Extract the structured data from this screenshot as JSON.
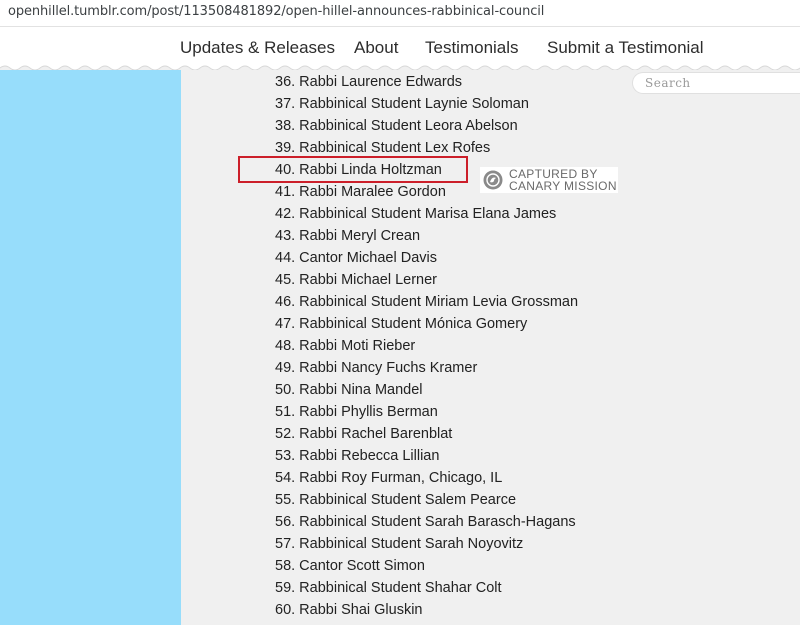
{
  "browser": {
    "url": "openhillel.tumblr.com/post/113508481892/open-hillel-announces-rabbinical-council"
  },
  "nav": {
    "items": [
      {
        "label": "Updates & Releases"
      },
      {
        "label": "About"
      },
      {
        "label": "Testimonials"
      },
      {
        "label": "Submit a Testimonial"
      }
    ]
  },
  "search": {
    "placeholder": "Search"
  },
  "colors": {
    "sidebar": "#97ddfb",
    "highlight_border": "#cc1f2a",
    "background": "#f0f0f0"
  },
  "list": {
    "items": [
      {
        "text": "36. Rabbi Laurence Edwards"
      },
      {
        "text": "37. Rabbinical Student Laynie Soloman"
      },
      {
        "text": "38. Rabbinical Student Leora Abelson"
      },
      {
        "text": "39. Rabbinical Student Lex Rofes"
      },
      {
        "text": "40. Rabbi Linda Holtzman"
      },
      {
        "text": "41. Rabbi Maralee Gordon"
      },
      {
        "text": "42. Rabbinical Student Marisa Elana James"
      },
      {
        "text": "43. Rabbi Meryl Crean"
      },
      {
        "text": "44. Cantor Michael Davis"
      },
      {
        "text": "45. Rabbi Michael Lerner"
      },
      {
        "text": "46. Rabbinical Student Miriam Levia Grossman"
      },
      {
        "text": "47. Rabbinical Student Mónica Gomery"
      },
      {
        "text": "48. Rabbi Moti Rieber"
      },
      {
        "text": "49. Rabbi Nancy Fuchs Kramer"
      },
      {
        "text": "50. Rabbi Nina Mandel"
      },
      {
        "text": "51. Rabbi Phyllis Berman"
      },
      {
        "text": "52. Rabbi Rachel Barenblat"
      },
      {
        "text": "53. Rabbi Rebecca Lillian"
      },
      {
        "text": "54. Rabbi Roy Furman, Chicago, IL"
      },
      {
        "text": "55. Rabbinical Student Salem Pearce"
      },
      {
        "text": "56. Rabbinical Student Sarah Barasch-Hagans"
      },
      {
        "text": "57. Rabbinical Student Sarah Noyovitz"
      },
      {
        "text": "58. Cantor Scott Simon"
      },
      {
        "text": "59. Rabbinical Student Shahar Colt"
      },
      {
        "text": "60. Rabbi Shai Gluskin"
      }
    ]
  },
  "watermark": {
    "line1": "CAPTURED BY",
    "line2": "CANARY MISSION",
    "icon": "canary-logo-icon"
  }
}
